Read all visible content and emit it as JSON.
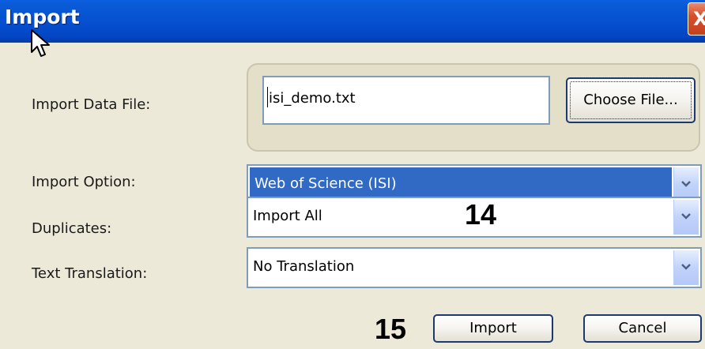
{
  "window": {
    "title": "Import",
    "close_glyph": "X"
  },
  "form": {
    "import_data_file_label": "Import Data File:",
    "file_value": "isi_demo.txt",
    "choose_file_label": "Choose File...",
    "import_option_label": "Import Option:",
    "import_option_value": "Web of Science (ISI)",
    "duplicates_label": "Duplicates:",
    "duplicates_value": "Import All",
    "text_translation_label": "Text Translation:",
    "text_translation_value": "No Translation"
  },
  "annotations": {
    "step_14": "14",
    "step_15": "15"
  },
  "buttons": {
    "import_label": "Import",
    "cancel_label": "Cancel"
  },
  "icons": {
    "close": "close-icon",
    "dropdown": "chevron-down-icon",
    "cursor": "mouse-pointer-icon"
  },
  "colors": {
    "titlebar": "#0551d1",
    "selection": "#316ac5",
    "dialog_bg": "#ece9d8",
    "close_button": "#d5502c"
  }
}
